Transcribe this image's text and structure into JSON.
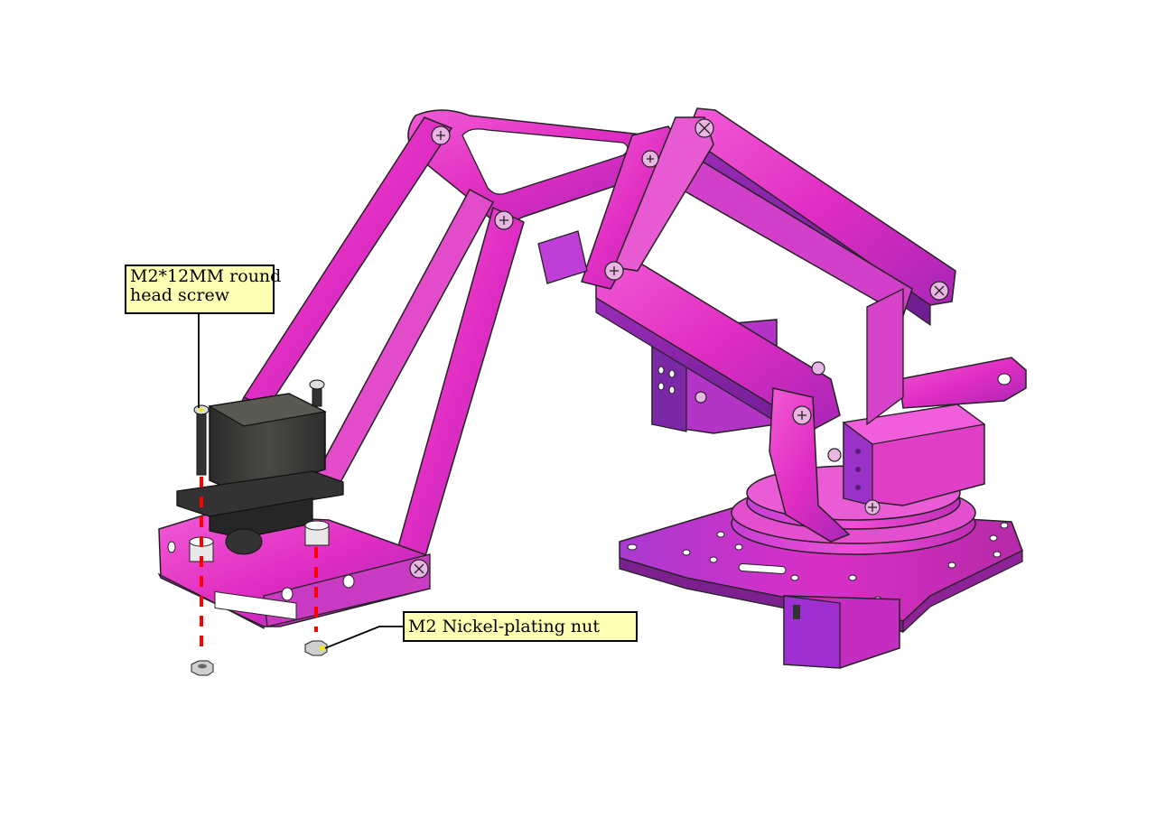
{
  "callouts": {
    "screw_line1": "M2*12MM round",
    "screw_line2": "head screw",
    "nut": "M2 Nickel-plating nut"
  },
  "colors": {
    "arm": "#e42fc4",
    "arm_dark": "#8a1f9c",
    "arm_light": "#f060d8",
    "servo": "#3c3c3c",
    "guide": "#ff0000",
    "callout_bg": "#ffffb4"
  }
}
